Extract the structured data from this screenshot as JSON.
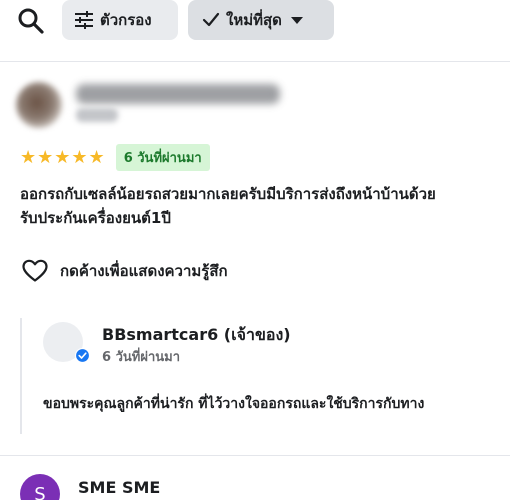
{
  "toolbar": {
    "search_icon": "search-icon",
    "filter_chip": {
      "icon": "sliders-icon",
      "label": "ตัวกรอง"
    },
    "sort_chip": {
      "check_icon": "check-icon",
      "label": "ใหม่ที่สุด",
      "caret_icon": "caret-down-icon"
    }
  },
  "review": {
    "rating": 5,
    "stars": "★★★★★",
    "date": "6 วันที่ผ่านมา",
    "text_line1": "ออกรถกับเซลล์น้อยรถสวยมากเลยครับมีบริการส่งถึงหน้าบ้านด้วย",
    "text_line2": "รับประกันเครื่องยนต์1ปี",
    "like_label": "กดค้างเพื่อแสดงความรู้สึก"
  },
  "reply": {
    "name": "BBsmartcar6 (เจ้าของ)",
    "date": "6 วันที่ผ่านมา",
    "text": "ขอบพระคุณลูกค้าที่น่ารัก ที่ไว้วางใจออกรถและใช้บริการกับทาง"
  },
  "next_review": {
    "avatar_letter": "S",
    "name": "SME SME"
  },
  "colors": {
    "star": "#f7b928",
    "badge_bg": "#d6f5d6",
    "badge_text": "#1c7a2c",
    "verified": "#1877f2",
    "next_avatar": "#7b2fb5"
  }
}
